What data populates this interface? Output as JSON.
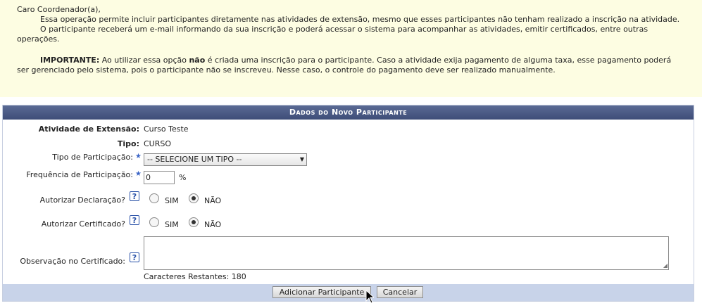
{
  "notice": {
    "greeting": "Caro Coordenador(a),",
    "para1": "Essa operação permite incluir participantes diretamente nas atividades de extensão, mesmo que esses participantes não tenham realizado a inscrição na atividade.",
    "para2": "O participante receberá um e-mail informando da sua inscrição e poderá acessar o sistema para acompanhar as atividades, emitir certificados, entre outras operações.",
    "important_label": "IMPORTANTE:",
    "important_text_a": "Ao utilizar essa opção",
    "important_bold": "não",
    "important_text_b": "é criada uma inscrição para o participante. Caso a atividade exija pagamento de alguma taxa, esse pagamento poderá ser gerenciado pelo sistema, pois o participante não se inscreveu. Nesse caso, o controle do pagamento deve ser realizado manualmente."
  },
  "form": {
    "caption": "Dados do Novo Participante",
    "atividade_label": "Atividade de Extensão:",
    "atividade_value": "Curso Teste",
    "tipo_label": "Tipo:",
    "tipo_value": "CURSO",
    "tipo_participacao_label": "Tipo de Participação:",
    "tipo_participacao_selected": "-- SELECIONE UM TIPO --",
    "frequencia_label": "Frequência de Participação:",
    "frequencia_value": "0",
    "frequencia_unit": "%",
    "declaracao_label": "Autorizar Declaração?",
    "certificado_label": "Autorizar Certificado?",
    "sim": "SIM",
    "nao": "NÃO",
    "help": "?",
    "required_mark": "★",
    "observacao_label": "Observação no Certificado:",
    "caracteres": "Caracteres Restantes: 180",
    "declaracao_selected": "NÃO",
    "certificado_selected": "NÃO"
  },
  "buttons": {
    "add": "Adicionar Participante",
    "cancel": "Cancelar"
  }
}
